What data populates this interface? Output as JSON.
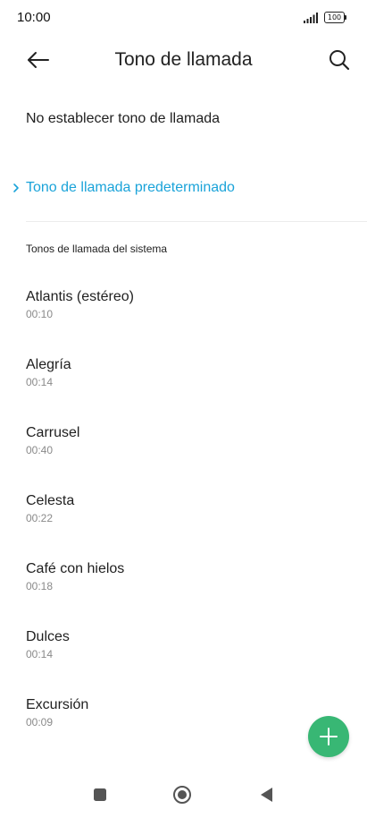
{
  "status": {
    "time": "10:00",
    "battery": "100"
  },
  "header": {
    "title": "Tono de llamada"
  },
  "options": {
    "none": "No establecer tono de llamada",
    "default": "Tono de llamada predeterminado"
  },
  "section": {
    "title": "Tonos de llamada del sistema"
  },
  "ringtones": [
    {
      "name": "Atlantis (estéreo)",
      "duration": "00:10"
    },
    {
      "name": "Alegría",
      "duration": "00:14"
    },
    {
      "name": "Carrusel",
      "duration": "00:40"
    },
    {
      "name": "Celesta",
      "duration": "00:22"
    },
    {
      "name": "Café con hielos",
      "duration": "00:18"
    },
    {
      "name": "Dulces",
      "duration": "00:14"
    },
    {
      "name": "Excursión",
      "duration": "00:09"
    }
  ],
  "colors": {
    "accent": "#1aa3d9",
    "fab": "#38b774"
  },
  "icons": {
    "back": "arrow-left-icon",
    "search": "search-icon",
    "add": "plus-icon"
  }
}
